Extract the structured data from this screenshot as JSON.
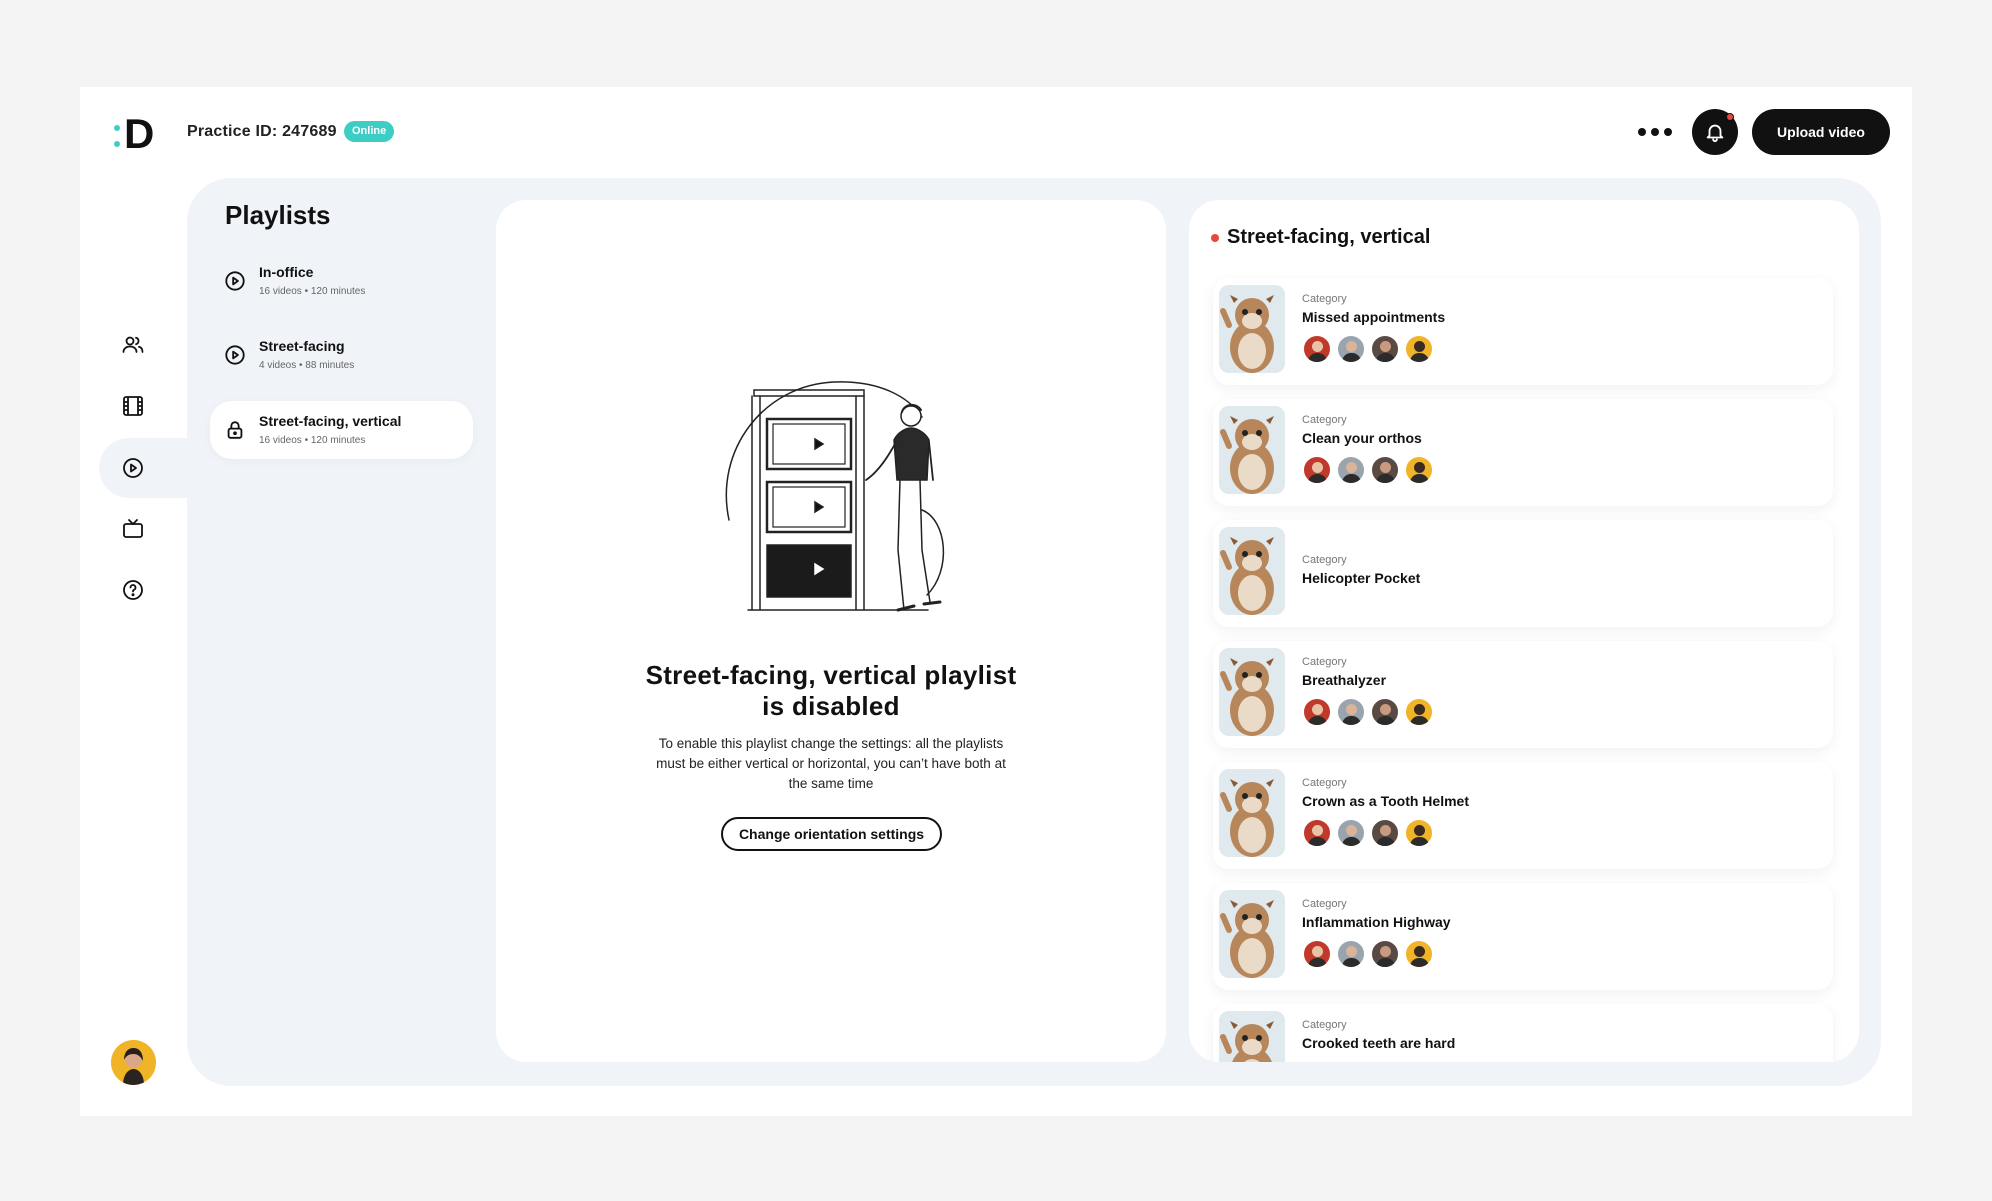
{
  "header": {
    "logo_text": "D",
    "practice_id": "Practice ID: 247689",
    "status_badge": "Online",
    "upload_label": "Upload video"
  },
  "sidebar": {
    "icons": [
      "users-icon",
      "film-icon",
      "play-circle-icon",
      "tv-icon",
      "help-icon"
    ],
    "active": "play-circle-icon"
  },
  "playlists": {
    "title": "Playlists",
    "items": [
      {
        "name": "In-office",
        "meta": "16 videos • 120 minutes",
        "icon": "play-circle-icon"
      },
      {
        "name": "Street-facing",
        "meta": "4 videos • 88 minutes",
        "icon": "play-circle-icon"
      },
      {
        "name": "Street-facing, vertical",
        "meta": "16 videos • 120 minutes",
        "icon": "lock-icon"
      }
    ]
  },
  "disabled_notice": {
    "title": "Street-facing, vertical playlist is disabled",
    "body": "To enable this playlist change the settings: all the playlists must be either vertical or horizontal, you can’t have both at the same time",
    "button": "Change orientation settings"
  },
  "videos": {
    "heading": "Street-facing, vertical",
    "items": [
      {
        "category": "Category",
        "name": "Missed appointments",
        "has_avatars": true
      },
      {
        "category": "Category",
        "name": "Clean your orthos",
        "has_avatars": true
      },
      {
        "category": "Category",
        "name": "Helicopter Pocket",
        "has_avatars": false
      },
      {
        "category": "Category",
        "name": "Breathalyzer",
        "has_avatars": true
      },
      {
        "category": "Category",
        "name": "Crown as a Tooth Helmet",
        "has_avatars": true
      },
      {
        "category": "Category",
        "name": "Inflammation Highway",
        "has_avatars": true
      },
      {
        "category": "Category",
        "name": "Crooked teeth are hard",
        "has_avatars": true
      }
    ]
  },
  "colors": {
    "accent_teal": "#3ccdc4",
    "alert_red": "#e6493c",
    "panel_bg": "#f0f3f7"
  }
}
